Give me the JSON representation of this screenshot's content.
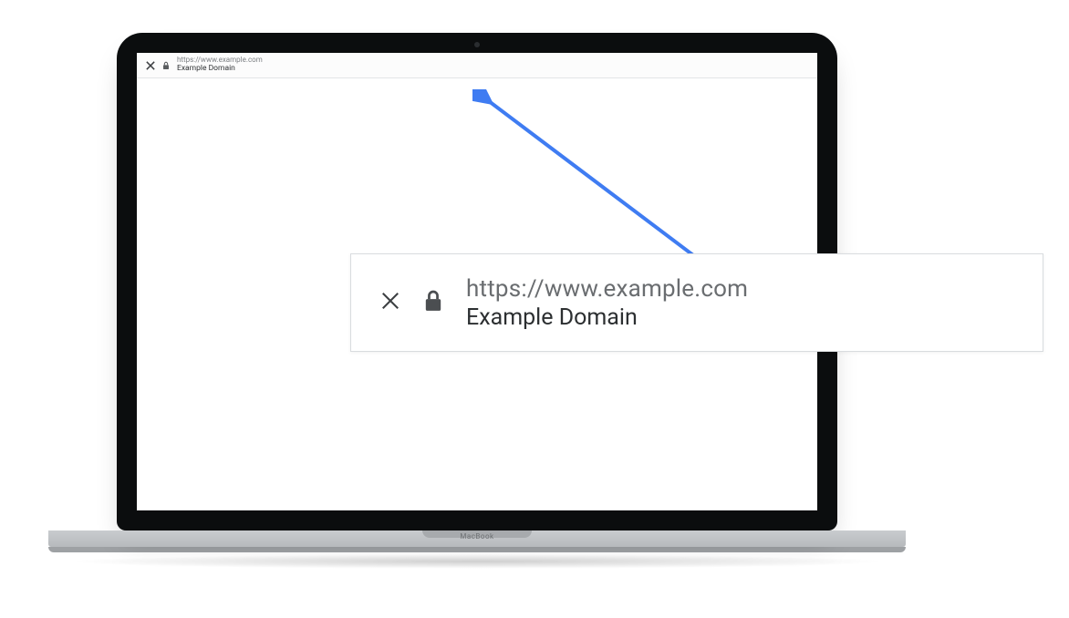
{
  "browser": {
    "url": "https://www.example.com",
    "title": "Example Domain"
  },
  "laptop": {
    "brand": "MacBook"
  },
  "callout": {
    "url": "https://www.example.com",
    "title": "Example Domain"
  }
}
